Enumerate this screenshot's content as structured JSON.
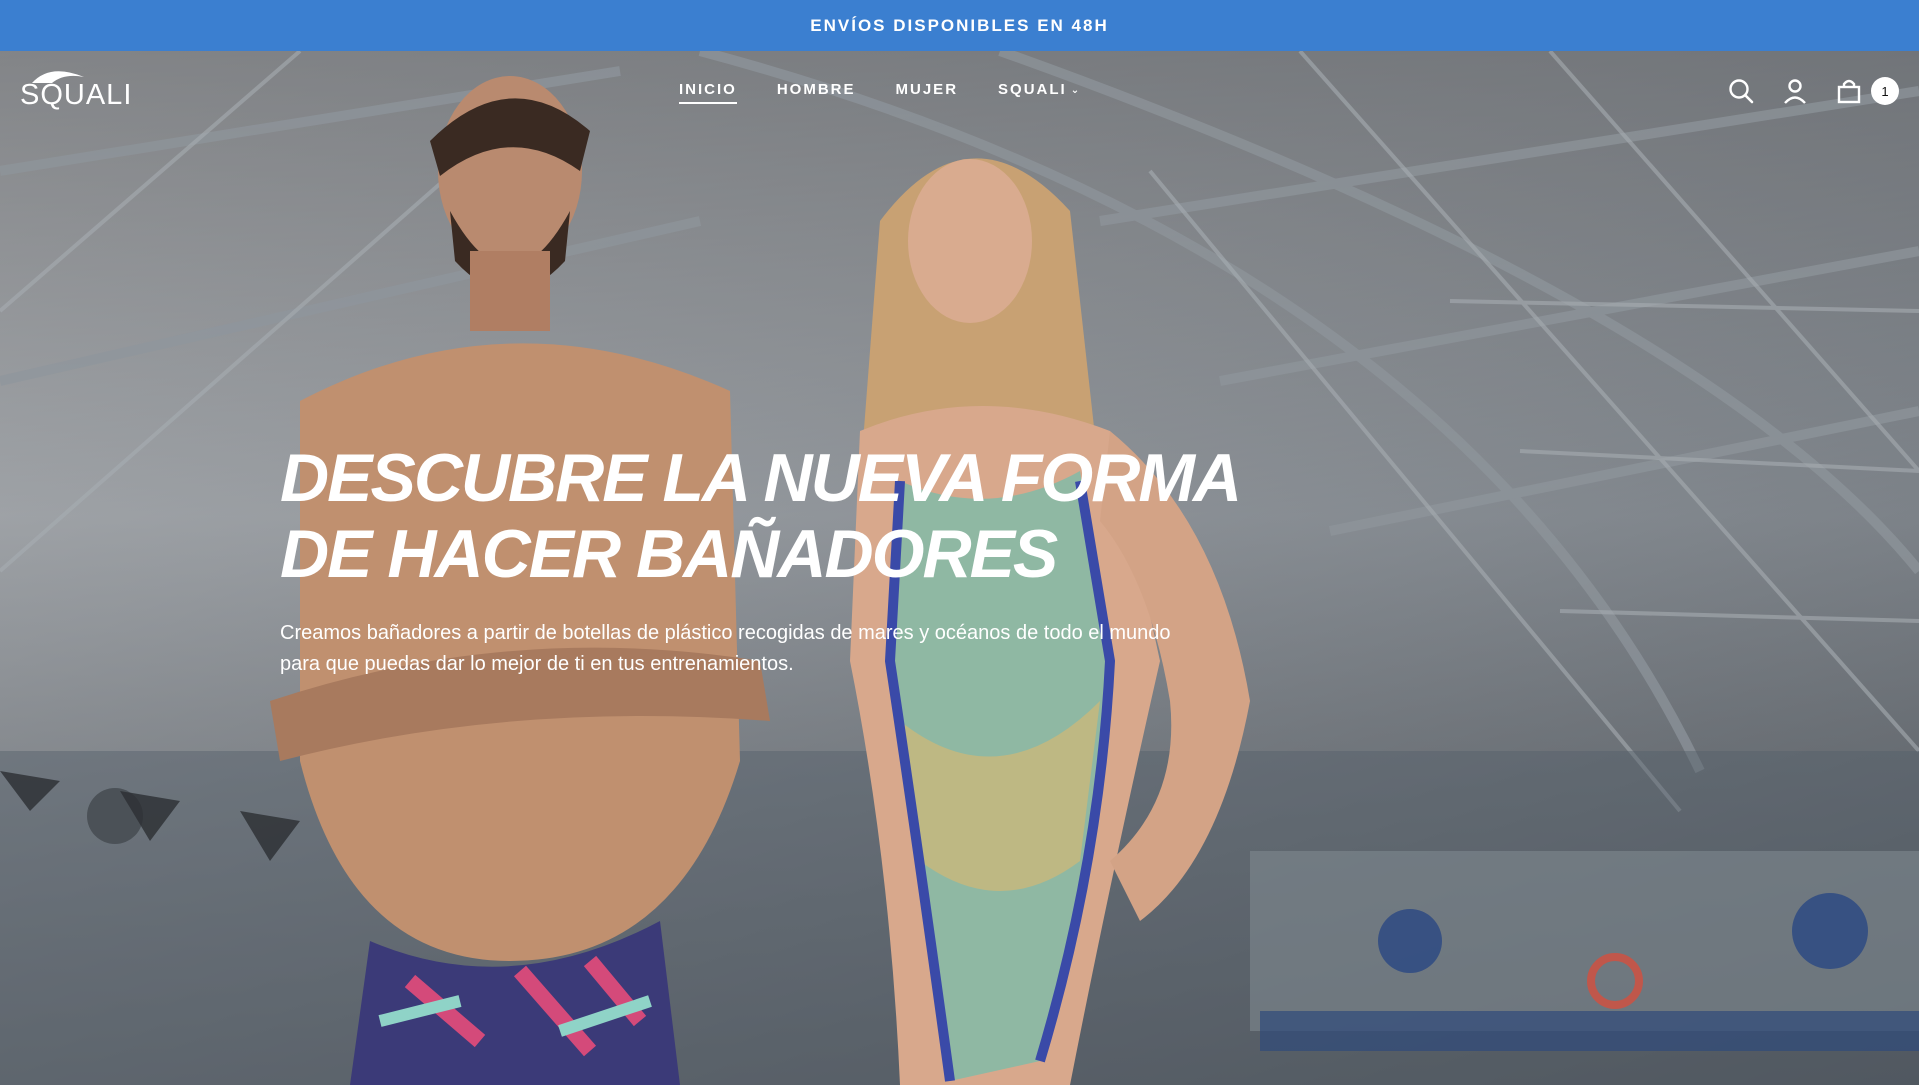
{
  "announcement": {
    "text": "ENVÍOS DISPONIBLES EN 48H"
  },
  "header": {
    "logo_text": "SQUALI",
    "nav": [
      {
        "label": "INICIO",
        "active": true
      },
      {
        "label": "HOMBRE",
        "active": false
      },
      {
        "label": "MUJER",
        "active": false
      },
      {
        "label": "SQUALI",
        "active": false,
        "has_dropdown": true
      }
    ],
    "icons": {
      "search": "search-icon",
      "account": "account-icon",
      "cart": "cart-icon"
    },
    "cart_count": "1"
  },
  "hero": {
    "title_line1": "DESCUBRE LA NUEVA FORMA",
    "title_line2": "DE HACER BAÑADORES",
    "subtitle_line1": "Creamos bañadores a partir de botellas de plástico recogidas de mares y océanos de todo el mundo",
    "subtitle_line2": "para que puedas dar lo mejor de ti en tus entrenamientos."
  },
  "colors": {
    "announcement_bg": "#3b7fd0",
    "text": "#ffffff"
  }
}
